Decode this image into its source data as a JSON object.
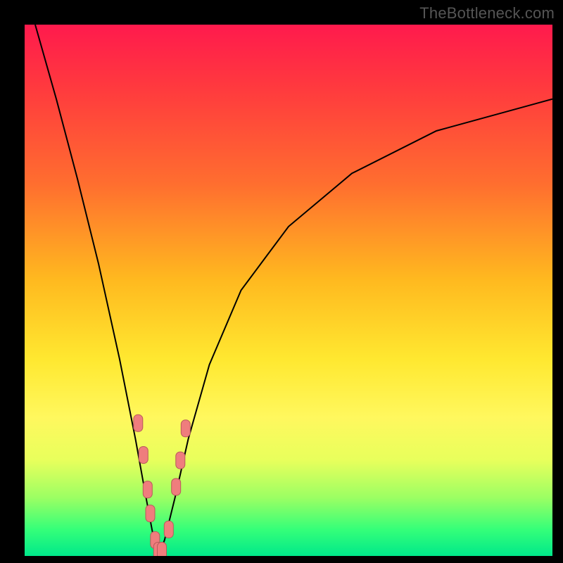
{
  "watermark": "TheBottleneck.com",
  "colors": {
    "background": "#000000",
    "gradient_top": "#ff1a4d",
    "gradient_mid_orange": "#ff6e2f",
    "gradient_mid_yellow": "#ffe830",
    "gradient_bottom": "#00e88a",
    "curve": "#000000",
    "marker_fill": "#ef7d7d",
    "marker_stroke": "#b85a5a"
  },
  "chart_data": {
    "type": "line",
    "title": "",
    "xlabel": "",
    "ylabel": "",
    "x_range": [
      0,
      100
    ],
    "y_range": [
      0,
      100
    ],
    "series": [
      {
        "name": "bottleneck-curve",
        "description": "V-shaped bottleneck curve; y roughly proportional to |x - x_min|, minimum near x≈25 where y≈0",
        "x_min": 25.3,
        "points": [
          {
            "x": 2.0,
            "y": 100.0
          },
          {
            "x": 6.0,
            "y": 86.0
          },
          {
            "x": 10.0,
            "y": 71.0
          },
          {
            "x": 14.0,
            "y": 55.0
          },
          {
            "x": 18.0,
            "y": 37.0
          },
          {
            "x": 21.0,
            "y": 22.0
          },
          {
            "x": 23.0,
            "y": 11.0
          },
          {
            "x": 24.5,
            "y": 3.0
          },
          {
            "x": 25.3,
            "y": 0.0
          },
          {
            "x": 26.5,
            "y": 3.0
          },
          {
            "x": 28.5,
            "y": 11.0
          },
          {
            "x": 31.0,
            "y": 22.0
          },
          {
            "x": 35.0,
            "y": 36.0
          },
          {
            "x": 41.0,
            "y": 50.0
          },
          {
            "x": 50.0,
            "y": 62.0
          },
          {
            "x": 62.0,
            "y": 72.0
          },
          {
            "x": 78.0,
            "y": 80.0
          },
          {
            "x": 100.0,
            "y": 86.0
          }
        ]
      }
    ],
    "markers": {
      "name": "highlight-dots",
      "description": "Salmon pill markers near the minimum of the curve",
      "points": [
        {
          "x": 21.5,
          "y": 25.0
        },
        {
          "x": 22.5,
          "y": 19.0
        },
        {
          "x": 23.3,
          "y": 12.5
        },
        {
          "x": 23.8,
          "y": 8.0
        },
        {
          "x": 24.7,
          "y": 3.0
        },
        {
          "x": 25.3,
          "y": 1.0
        },
        {
          "x": 26.0,
          "y": 1.0
        },
        {
          "x": 27.3,
          "y": 5.0
        },
        {
          "x": 28.7,
          "y": 13.0
        },
        {
          "x": 29.5,
          "y": 18.0
        },
        {
          "x": 30.5,
          "y": 24.0
        }
      ]
    }
  }
}
